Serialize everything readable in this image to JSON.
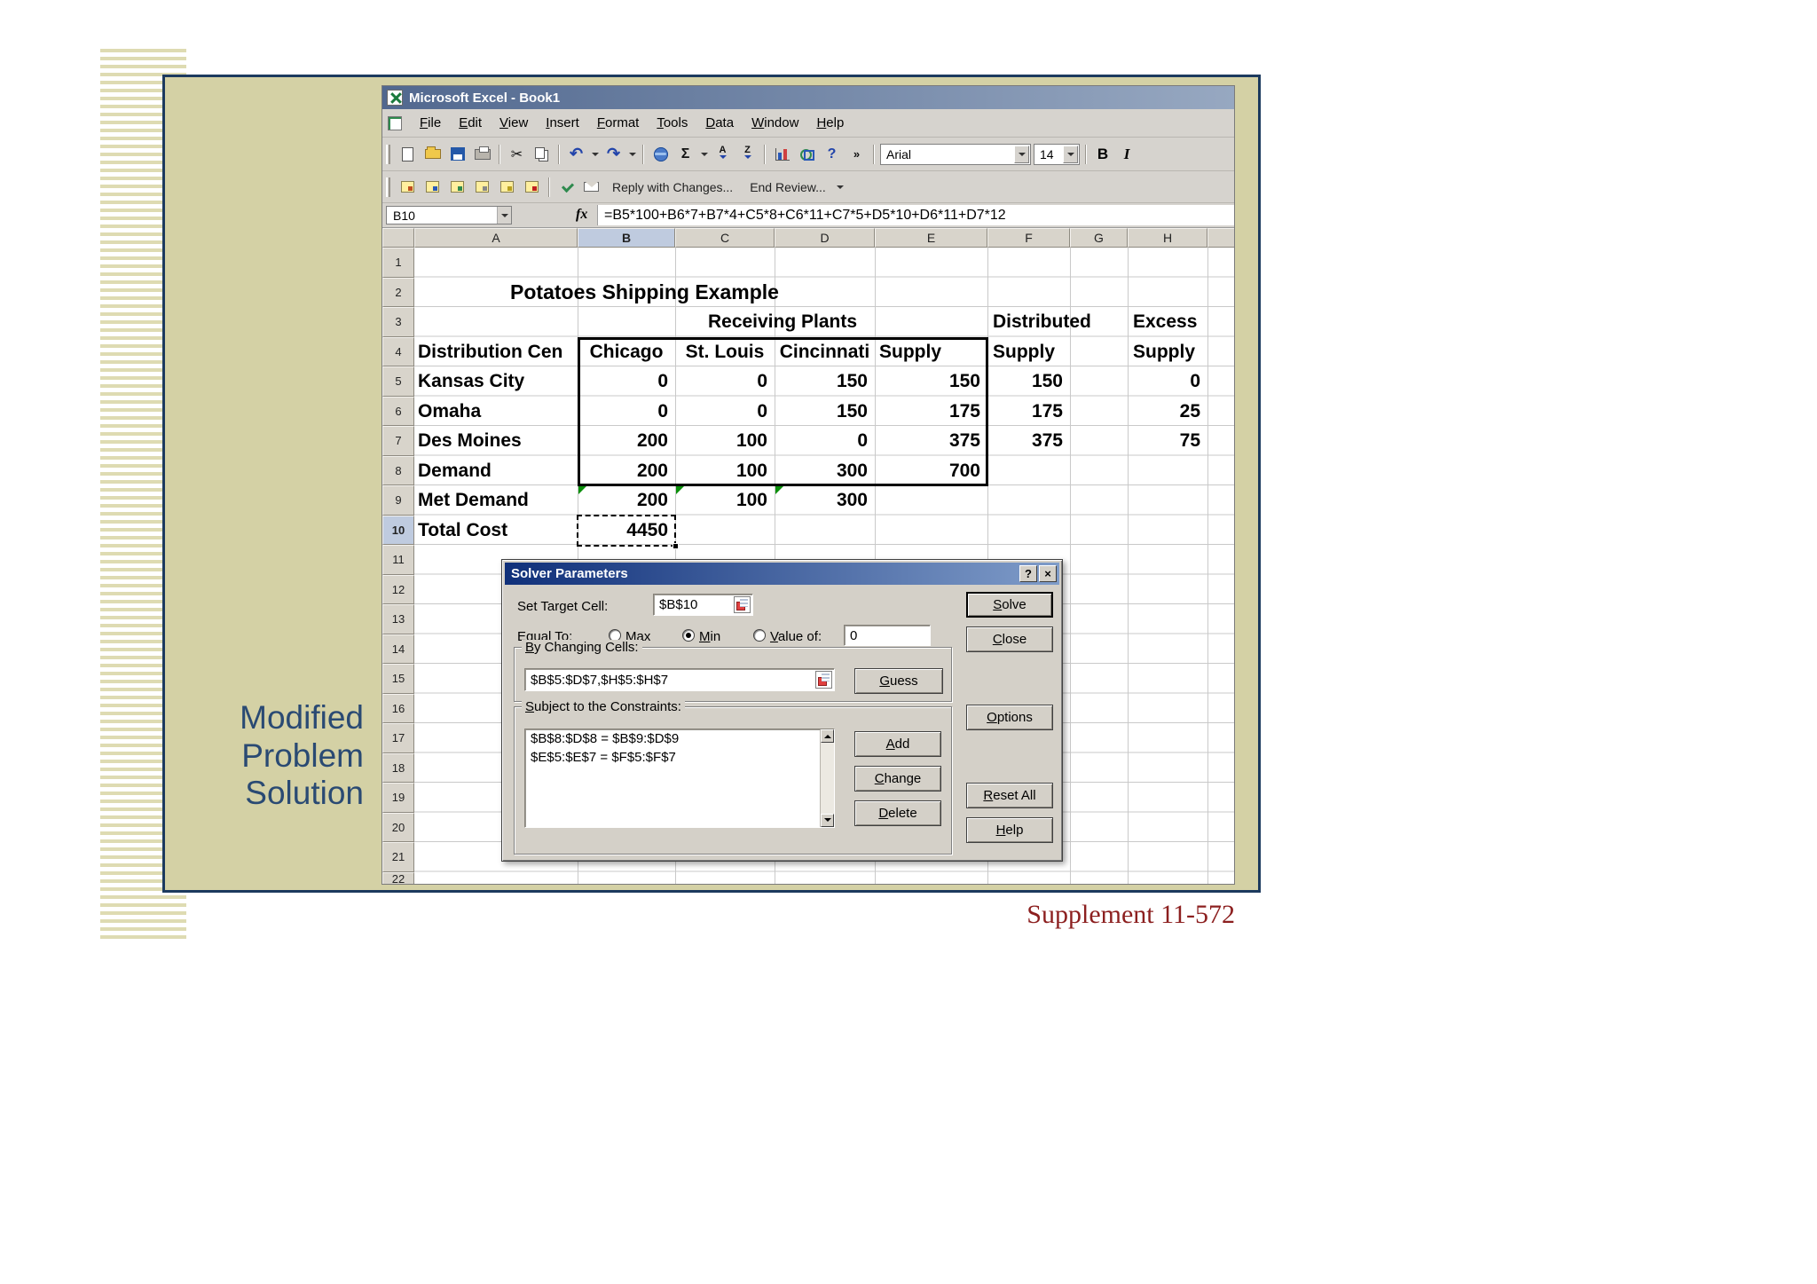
{
  "slide": {
    "side_label": "Modified\nProblem\nSolution",
    "footer": "Supplement 11-572"
  },
  "excel": {
    "window_title": "Microsoft Excel - Book1",
    "menu_items": [
      "File",
      "Edit",
      "View",
      "Insert",
      "Format",
      "Tools",
      "Data",
      "Window",
      "Help"
    ],
    "toolbar": {
      "font_name": "Arial",
      "font_size": "14",
      "reply_with_changes": "Reply with Changes...",
      "end_review": "End Review..."
    },
    "glyphs": {
      "cut": "✂",
      "undo": "↶",
      "redo": "↷",
      "autosum": "Σ",
      "help": "?",
      "sort_a": "A",
      "sort_z": "Z",
      "more": "»",
      "bold": "B",
      "italic": "I",
      "fx": "fx"
    },
    "name_box": "B10",
    "formula": "=B5*100+B6*7+B7*4+C5*8+C6*11+C7*5+D5*10+D6*11+D7*12",
    "columns": [
      "A",
      "B",
      "C",
      "D",
      "E",
      "F",
      "G",
      "H"
    ],
    "row_numbers": [
      "1",
      "2",
      "3",
      "4",
      "5",
      "6",
      "7",
      "8",
      "9",
      "10",
      "11",
      "12",
      "13",
      "14",
      "15",
      "16",
      "17",
      "18",
      "19",
      "20",
      "21",
      "22"
    ]
  },
  "sheet": {
    "title": "Potatoes Shipping Example",
    "receiving_plants": "Receiving Plants",
    "distributed": "Distributed",
    "excess": "Excess",
    "headers": {
      "a": "Distribution Cen",
      "b": "Chicago",
      "c": "St. Louis",
      "d": "Cincinnati",
      "e": "Supply",
      "f": "Supply",
      "h": "Supply"
    },
    "rows": [
      {
        "label": "Kansas City",
        "b": "0",
        "c": "0",
        "d": "150",
        "e": "150",
        "f": "150",
        "h": "0"
      },
      {
        "label": "Omaha",
        "b": "0",
        "c": "0",
        "d": "150",
        "e": "175",
        "f": "175",
        "h": "25"
      },
      {
        "label": "Des Moines",
        "b": "200",
        "c": "100",
        "d": "0",
        "e": "375",
        "f": "375",
        "h": "75"
      },
      {
        "label": "Demand",
        "b": "200",
        "c": "100",
        "d": "300",
        "e": "700"
      },
      {
        "label": "Met Demand",
        "b": "200",
        "c": "100",
        "d": "300"
      },
      {
        "label": "Total Cost",
        "b": "4450"
      }
    ]
  },
  "solver": {
    "title": "Solver Parameters",
    "help_glyph": "?",
    "close_glyph": "×",
    "set_target_label": "Set Target Cell:",
    "target_cell": "$B$10",
    "equal_to_label": "Equal To:",
    "max_label": "Max",
    "min_label": "Min",
    "value_of_label": "Value of:",
    "value_of_value": "0",
    "by_changing_label": "By Changing Cells:",
    "changing_cells": "$B$5:$D$7,$H$5:$H$7",
    "constraints_label": "Subject to the Constraints:",
    "constraints": [
      "$B$8:$D$8 = $B$9:$D$9",
      "$E$5:$E$7 = $F$5:$F$7"
    ],
    "buttons": {
      "solve": "Solve",
      "close": "Close",
      "guess": "Guess",
      "options": "Options",
      "add": "Add",
      "change": "Change",
      "delete": "Delete",
      "reset_all": "Reset All",
      "help": "Help"
    }
  }
}
